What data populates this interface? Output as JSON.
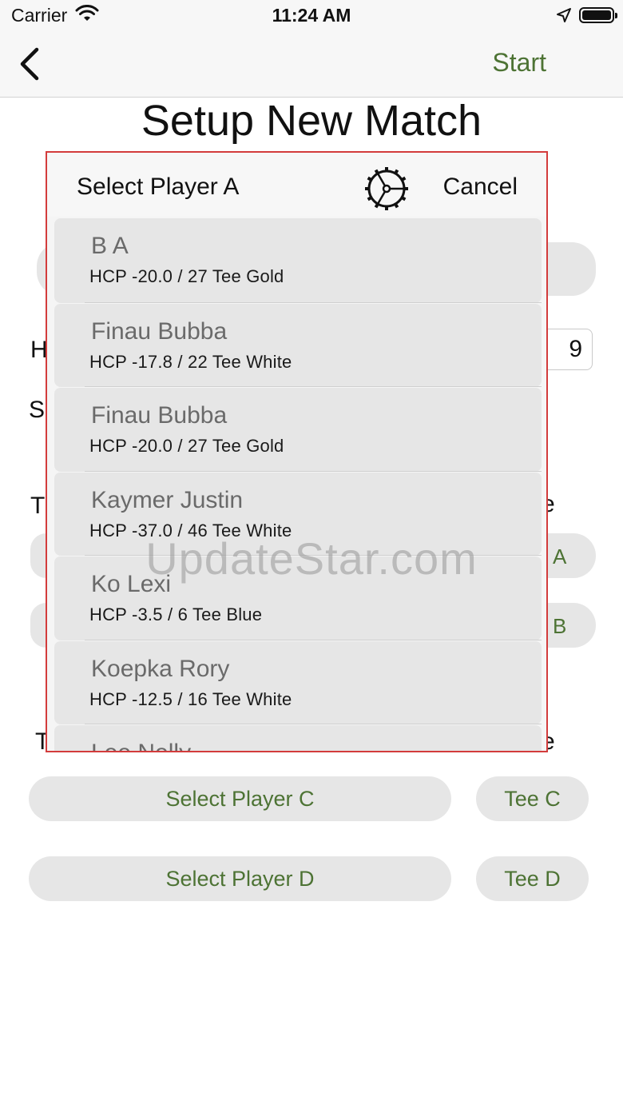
{
  "status_bar": {
    "carrier": "Carrier",
    "time": "11:24 AM"
  },
  "nav": {
    "start_label": "Start"
  },
  "page": {
    "title": "Setup New Match"
  },
  "background": {
    "holes_value": "9",
    "holes_letter": "H",
    "section_letter": "S",
    "team1_letter": "T",
    "team1_trailing": "e",
    "tee_a": "A",
    "tee_b": "B",
    "team2_letter": "T",
    "team2_trailing": "e",
    "select_player_c": "Select Player C",
    "tee_c": "Tee C",
    "select_player_d": "Select Player D",
    "tee_d": "Tee D"
  },
  "popover": {
    "title": "Select Player A",
    "cancel_label": "Cancel",
    "players": [
      {
        "name": "B A",
        "detail": "HCP -20.0 / 27 Tee Gold"
      },
      {
        "name": "Finau Bubba",
        "detail": "HCP -17.8 / 22 Tee White"
      },
      {
        "name": "Finau Bubba",
        "detail": "HCP -20.0 / 27 Tee Gold"
      },
      {
        "name": "Kaymer Justin",
        "detail": "HCP -37.0 / 46 Tee White"
      },
      {
        "name": "Ko Lexi",
        "detail": "HCP -3.5 / 6 Tee Blue"
      },
      {
        "name": "Koepka Rory",
        "detail": "HCP -12.5 / 16 Tee White"
      },
      {
        "name": "Lee Nelly",
        "detail": ""
      }
    ]
  },
  "watermark": "UpdateStar.com",
  "colors": {
    "accent_green": "#4d7334",
    "popover_border": "#d33c3c",
    "row_bg": "#e6e6e6"
  }
}
